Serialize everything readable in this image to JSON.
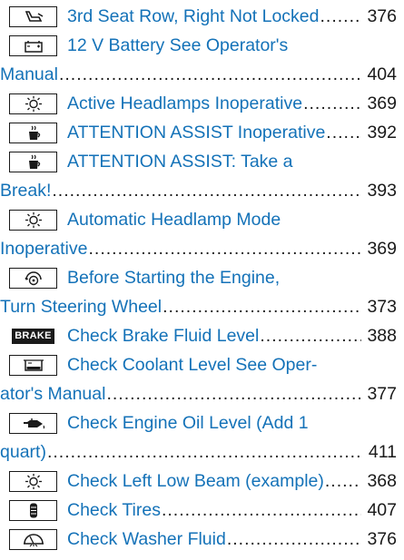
{
  "entries": [
    {
      "icon": "seat-icon",
      "line1": "3rd Seat Row, Right Not Locked",
      "line2": "",
      "page": "376"
    },
    {
      "icon": "battery-icon",
      "line1": "12 V Battery See Operator's",
      "line2": "Manual",
      "page": "404"
    },
    {
      "icon": "headlamp-icon",
      "line1": "Active Headlamps Inoperative",
      "line2": "",
      "page": "369"
    },
    {
      "icon": "coffee-cup-icon",
      "line1": "ATTENTION ASSIST Inoperative",
      "line2": "",
      "page": "392"
    },
    {
      "icon": "coffee-cup-icon",
      "line1": "ATTENTION ASSIST: Take a",
      "line2": "Break!",
      "page": "393"
    },
    {
      "icon": "headlamp-icon",
      "line1": "Automatic Headlamp Mode",
      "line2": "Inoperative",
      "page": "369"
    },
    {
      "icon": "steering-wheel-icon",
      "line1": "Before Starting the Engine,",
      "line2": "Turn Steering Wheel",
      "page": "373"
    },
    {
      "icon": "brake-icon",
      "icon_text": "BRAKE",
      "line1": "Check Brake Fluid Level",
      "line2": "",
      "page": "388"
    },
    {
      "icon": "coolant-icon",
      "line1": "Check Coolant Level See Oper-",
      "line2": "ator's Manual",
      "page": "377"
    },
    {
      "icon": "oil-can-icon",
      "line1": "Check Engine Oil Level (Add 1",
      "line2": "quart)",
      "page": "411"
    },
    {
      "icon": "headlamp-icon",
      "line1": "Check Left Low Beam (example)",
      "line2": "",
      "page": "368"
    },
    {
      "icon": "tire-icon",
      "line1": "Check Tires",
      "line2": "",
      "page": "407"
    },
    {
      "icon": "washer-fluid-icon",
      "line1": "Check Washer Fluid",
      "line2": "",
      "page": "376"
    }
  ]
}
